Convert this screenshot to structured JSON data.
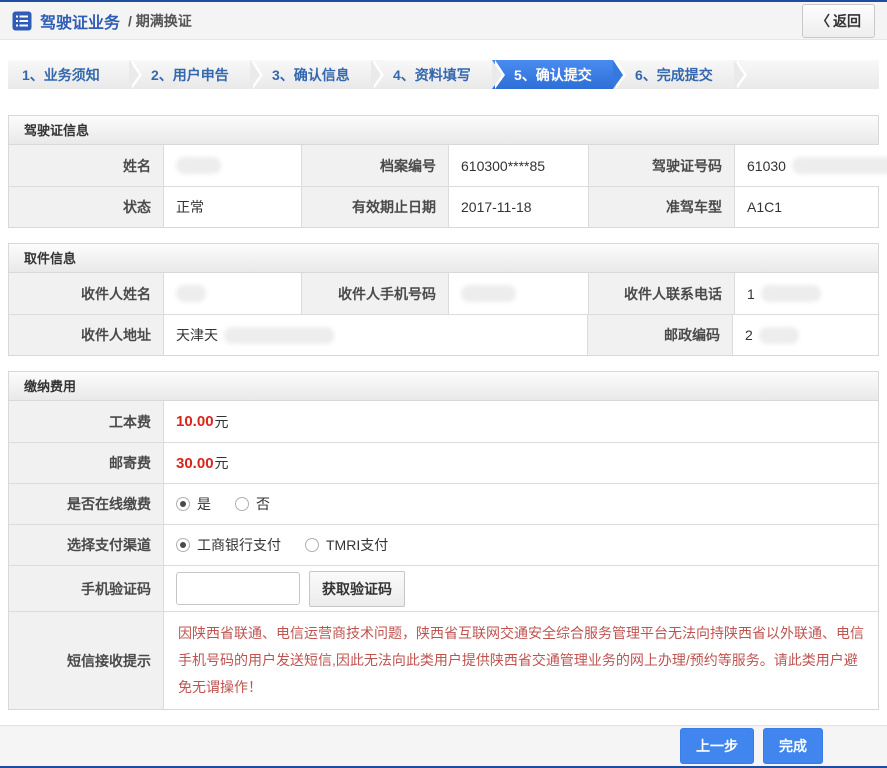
{
  "colors": {
    "accent_blue": "#3d7de5",
    "title_blue": "#2f5db5",
    "navy_line": "#1f4ba0",
    "fee_red": "#d9261c",
    "warning_red": "#bf5350"
  },
  "header": {
    "title": "驾驶证业务",
    "subtitle": "/ 期满换证",
    "back_icon": "〈",
    "back_label": "返回"
  },
  "steps": {
    "items": [
      {
        "label": "1、业务须知",
        "active": false
      },
      {
        "label": "2、用户申告",
        "active": false
      },
      {
        "label": "3、确认信息",
        "active": false
      },
      {
        "label": "4、资料填写",
        "active": false
      },
      {
        "label": "5、确认提交",
        "active": true
      },
      {
        "label": "6、完成提交",
        "active": false
      }
    ]
  },
  "license_section": {
    "title": "驾驶证信息",
    "rows": [
      [
        {
          "label": "姓名",
          "value": ""
        },
        {
          "label": "档案编号",
          "value": "610300****85"
        },
        {
          "label": "驾驶证号码",
          "value": "61030"
        }
      ],
      [
        {
          "label": "状态",
          "value": "正常"
        },
        {
          "label": "有效期止日期",
          "value": "2017-11-18"
        },
        {
          "label": "准驾车型",
          "value": "A1C1"
        }
      ]
    ]
  },
  "pickup_section": {
    "title": "取件信息",
    "row1": [
      {
        "label": "收件人姓名",
        "value": ""
      },
      {
        "label": "收件人手机号码",
        "value": ""
      },
      {
        "label": "收件人联系电话",
        "value": "1"
      }
    ],
    "row2": {
      "address_label": "收件人地址",
      "address_value": "天津天",
      "postal_label": "邮政编码",
      "postal_value": "2"
    }
  },
  "payment_section": {
    "title": "缴纳费用",
    "fees": [
      {
        "label": "工本费",
        "amount": "10.00",
        "unit": "元"
      },
      {
        "label": "邮寄费",
        "amount": "30.00",
        "unit": "元"
      }
    ],
    "online_pay": {
      "label": "是否在线缴费",
      "options": [
        {
          "label": "是",
          "selected": true
        },
        {
          "label": "否",
          "selected": false
        }
      ]
    },
    "channel": {
      "label": "选择支付渠道",
      "options": [
        {
          "label": "工商银行支付",
          "selected": true
        },
        {
          "label": "TMRI支付",
          "selected": false
        }
      ]
    },
    "sms_code": {
      "label": "手机验证码",
      "input_value": "",
      "button_label": "获取验证码"
    },
    "sms_notice": {
      "label": "短信接收提示",
      "text": "因陕西省联通、电信运营商技术问题，陕西省互联网交通安全综合服务管理平台无法向持陕西省以外联通、电信手机号码的用户发送短信,因此无法向此类用户提供陕西省交通管理业务的网上办理/预约等服务。请此类用户避免无谓操作！"
    }
  },
  "footer": {
    "prev_label": "上一步",
    "finish_label": "完成"
  }
}
